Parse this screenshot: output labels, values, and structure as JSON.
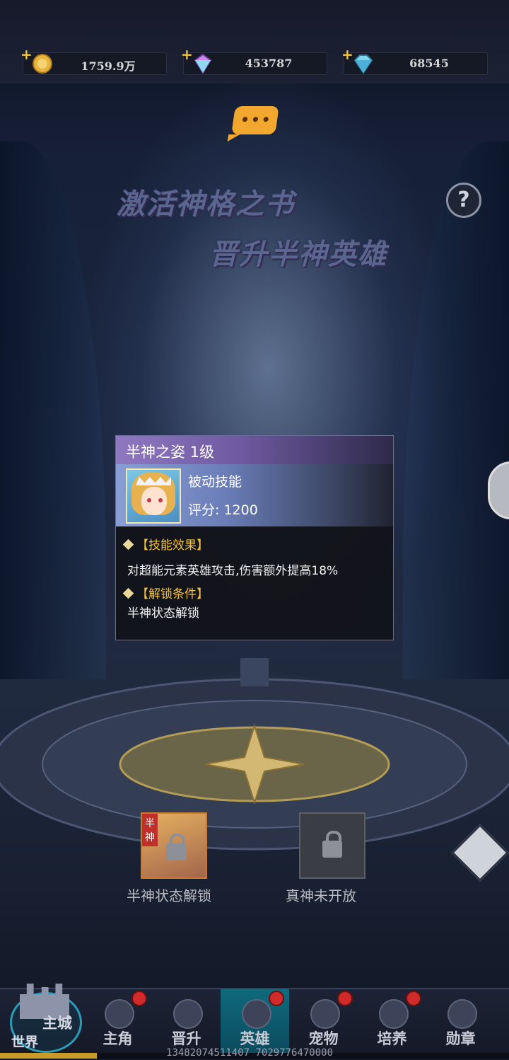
{
  "currencies": [
    {
      "name": "gold-coin-icon",
      "value": "1759.9万"
    },
    {
      "name": "crystal-icon",
      "value": "453787"
    },
    {
      "name": "diamond-icon",
      "value": "68545"
    }
  ],
  "banner": {
    "line1": "激活神格之书",
    "line2": "晋升半神英雄",
    "help": "?"
  },
  "skill_popup": {
    "title": "半神之姿 1级",
    "type": "被动技能",
    "score": "评分: 1200",
    "effect_header": "【技能效果】",
    "effect_text": "对超能元素英雄攻击,伤害额外提高18%",
    "unlock_header": "【解锁条件】",
    "unlock_text": "半神状态解锁"
  },
  "stages": {
    "demigod": {
      "tag": "半神",
      "label": "半神状态解锁"
    },
    "true_god": {
      "label": "真神未开放"
    }
  },
  "nav": {
    "home_top": "主城",
    "home_bottom": "世界",
    "items": [
      {
        "label": "主角",
        "badge": true
      },
      {
        "label": "晋升",
        "badge": false
      },
      {
        "label": "英雄",
        "badge": true,
        "active": true
      },
      {
        "label": "宠物",
        "badge": true
      },
      {
        "label": "培养",
        "badge": true
      },
      {
        "label": "勋章",
        "badge": false
      }
    ]
  },
  "debug_text": "13482074511407 7029776470000",
  "progress": 0.19,
  "colors": {
    "accent": "#f2c23a",
    "popup_header": "#8f78c0",
    "badge": "#d12a2a"
  }
}
